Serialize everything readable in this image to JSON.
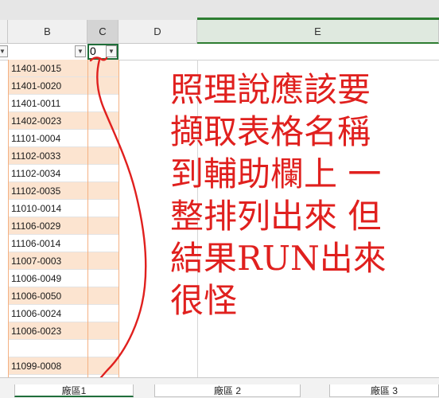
{
  "columns": {
    "a_partial": "",
    "b": "B",
    "c": "C",
    "d": "D",
    "e": "E"
  },
  "filter": {
    "c_value": "0",
    "dropdown_glyph": "▼"
  },
  "rows": [
    {
      "b": "11401-0015",
      "shaded": true
    },
    {
      "b": "11401-0020",
      "shaded": true
    },
    {
      "b": "11401-0011",
      "shaded": false
    },
    {
      "b": "11402-0023",
      "shaded": true
    },
    {
      "b": "11101-0004",
      "shaded": false
    },
    {
      "b": "11102-0033",
      "shaded": true
    },
    {
      "b": "11102-0034",
      "shaded": false
    },
    {
      "b": "11102-0035",
      "shaded": true
    },
    {
      "b": "11010-0014",
      "shaded": false
    },
    {
      "b": "11106-0029",
      "shaded": true
    },
    {
      "b": "11106-0014",
      "shaded": false
    },
    {
      "b": "11007-0003",
      "shaded": true
    },
    {
      "b": "11006-0049",
      "shaded": false
    },
    {
      "b": "11006-0050",
      "shaded": true
    },
    {
      "b": "11006-0024",
      "shaded": false
    },
    {
      "b": "11006-0023",
      "shaded": true
    },
    {
      "b": "",
      "shaded": false
    },
    {
      "b": "11099-0008",
      "shaded": true
    }
  ],
  "annotation": {
    "lines": [
      "照理說應該要",
      "擷取表格名稱",
      "到輔助欄上 一",
      "整排列出來 但",
      "結果RUN出來",
      "很怪"
    ],
    "color": "#e0201e"
  },
  "sheet_tabs": [
    {
      "label": "廠區1",
      "active": true
    },
    {
      "label": "廠區 2",
      "active": false
    },
    {
      "label": "廠區 3",
      "active": false
    }
  ]
}
